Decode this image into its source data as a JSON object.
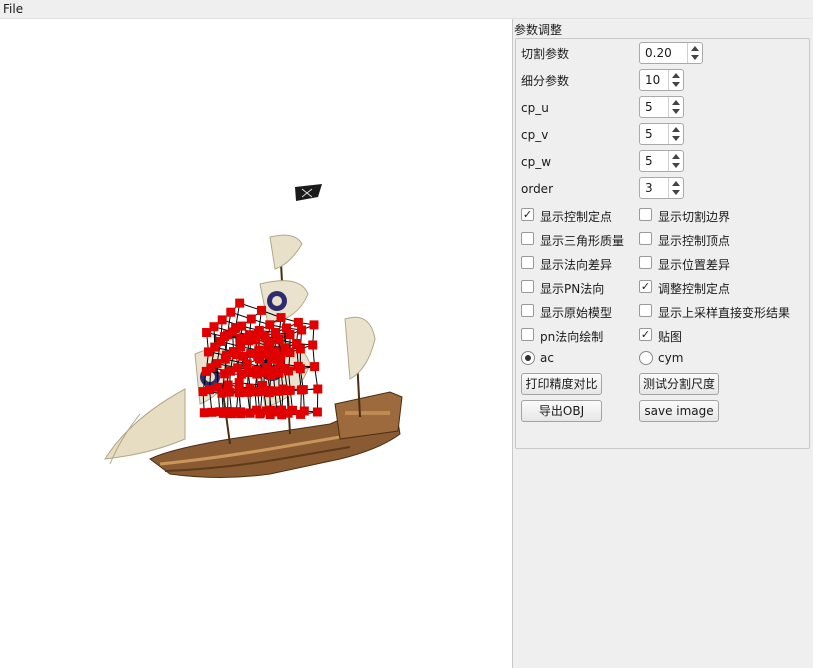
{
  "menubar": {
    "file_label": "File"
  },
  "panel": {
    "title": "参数调整",
    "params": [
      {
        "label": "切割参数",
        "value": "0.20"
      },
      {
        "label": "细分参数",
        "value": "10"
      },
      {
        "label": "cp_u",
        "value": "5"
      },
      {
        "label": "cp_v",
        "value": "5"
      },
      {
        "label": "cp_w",
        "value": "5"
      },
      {
        "label": "order",
        "value": "3"
      }
    ],
    "checkboxes": [
      {
        "label": "显示控制定点",
        "checked": true
      },
      {
        "label": "显示切割边界",
        "checked": false
      },
      {
        "label": "显示三角形质量",
        "checked": false
      },
      {
        "label": "显示控制顶点",
        "checked": false
      },
      {
        "label": "显示法向差异",
        "checked": false
      },
      {
        "label": "显示位置差异",
        "checked": false
      },
      {
        "label": "显示PN法向",
        "checked": false
      },
      {
        "label": "调整控制定点",
        "checked": true
      },
      {
        "label": "显示原始模型",
        "checked": false
      },
      {
        "label": "显示上采样直接变形结果",
        "checked": false
      },
      {
        "label": "pn法向绘制",
        "checked": false
      },
      {
        "label": "贴图",
        "checked": true
      }
    ],
    "radios": [
      {
        "label": "ac",
        "selected": true
      },
      {
        "label": "cym",
        "selected": false
      }
    ],
    "buttons": {
      "print_precision": "打印精度对比",
      "test_scale": "测试分割尺度",
      "export_obj": "导出OBJ",
      "save_image": "save image"
    }
  },
  "viewport": {
    "control_point_color": "#e00000",
    "line_color": "#000000",
    "model": "pirate-ship"
  }
}
